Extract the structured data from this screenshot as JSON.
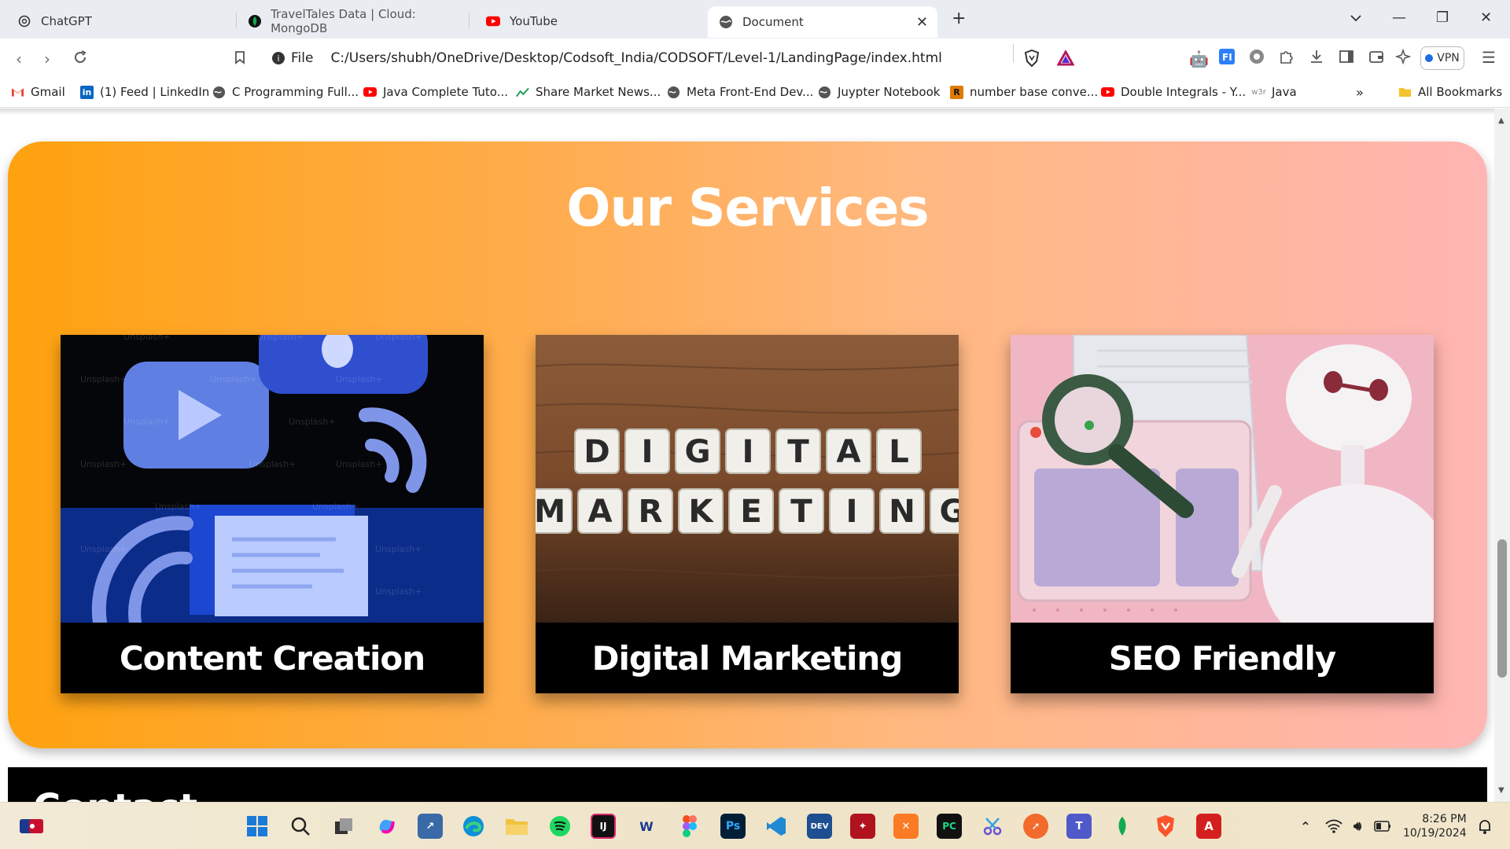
{
  "browser": {
    "tabs": [
      {
        "title": "ChatGPT",
        "icon": "chatgpt-icon"
      },
      {
        "title": "TravelTales Data | Cloud: MongoDB",
        "icon": "mongodb-leaf-icon"
      },
      {
        "title": "YouTube",
        "icon": "youtube-icon"
      },
      {
        "title": "Document",
        "icon": "globe-icon",
        "active": true
      }
    ],
    "address": {
      "scheme_label": "File",
      "url": "C:/Users/shubh/OneDrive/Desktop/Codsoft_India/CODSOFT/Level-1/LandingPage/index.html"
    },
    "vpn_label": "VPN",
    "bookmarks": [
      {
        "label": "Gmail",
        "icon": "gmail-icon"
      },
      {
        "label": "(1) Feed | LinkedIn",
        "icon": "linkedin-icon"
      },
      {
        "label": "C Programming Full...",
        "icon": "globe-icon"
      },
      {
        "label": "Java Complete Tuto...",
        "icon": "youtube-icon"
      },
      {
        "label": "Share Market News...",
        "icon": "chart-icon"
      },
      {
        "label": "Meta Front-End Dev...",
        "icon": "globe-icon"
      },
      {
        "label": "Juypter Notebook",
        "icon": "globe-icon"
      },
      {
        "label": "number base conve...",
        "icon": "r-icon"
      },
      {
        "label": "Double Integrals - Y...",
        "icon": "youtube-icon"
      },
      {
        "label": "Java",
        "icon": "w3schools-icon"
      }
    ],
    "all_bookmarks_label": "All Bookmarks"
  },
  "page": {
    "section_title": "Our Services",
    "services": [
      {
        "caption": "Content Creation"
      },
      {
        "caption": "Digital Marketing",
        "tiles_row1": [
          "D",
          "I",
          "G",
          "I",
          "T",
          "A",
          "L"
        ],
        "tiles_row2": [
          "M",
          "A",
          "R",
          "K",
          "E",
          "T",
          "I",
          "N",
          "G"
        ]
      },
      {
        "caption": "SEO Friendly"
      }
    ],
    "watermark": "Unsplash+",
    "next_section_heading": "Contact"
  },
  "taskbar": {
    "time": "8:26 PM",
    "date": "10/19/2024"
  }
}
